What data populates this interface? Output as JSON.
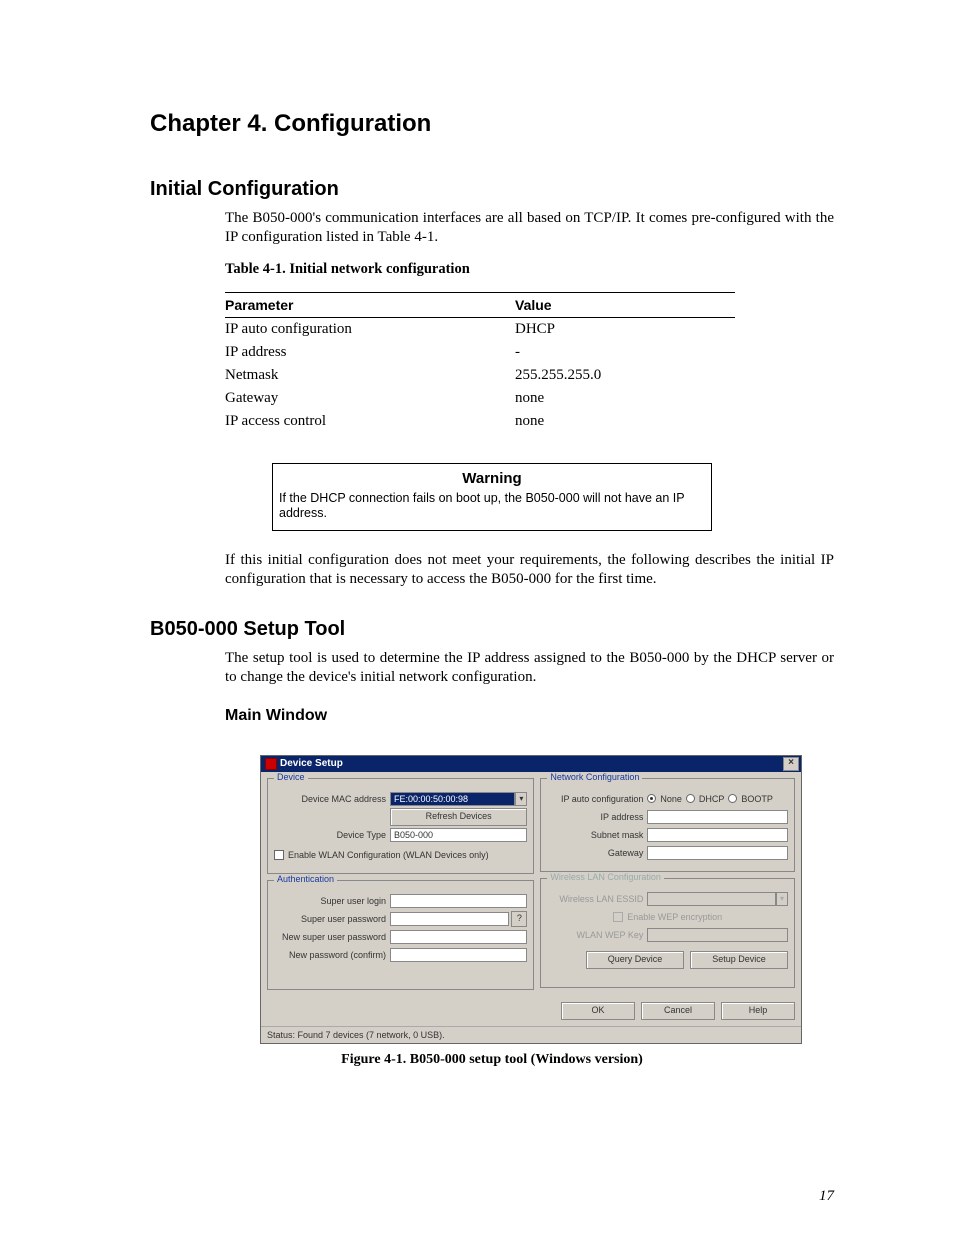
{
  "chapter_title": "Chapter 4. Configuration",
  "section1": {
    "title": "Initial Configuration",
    "intro": "The B050-000's communication interfaces are all based on TCP/IP. It comes pre-configured with the IP configuration listed in Table 4-1.",
    "table_caption": "Table 4-1. Initial network configuration",
    "table_headers": {
      "param": "Parameter",
      "value": "Value"
    },
    "table_rows": [
      {
        "param": "IP auto configuration",
        "value": "DHCP"
      },
      {
        "param": "IP address",
        "value": "-"
      },
      {
        "param": "Netmask",
        "value": "255.255.255.0"
      },
      {
        "param": "Gateway",
        "value": "none"
      },
      {
        "param": "IP access control",
        "value": "none"
      }
    ],
    "warning_title": "Warning",
    "warning_body": "If the DHCP connection fails on boot up, the B050-000 will not have an IP address.",
    "after": "If this initial configuration does not meet your requirements, the following describes the initial IP configuration that is necessary to access the B050-000 for the first time."
  },
  "section2": {
    "title": "B050-000 Setup Tool",
    "intro": "The setup tool is used to determine the IP address assigned to the B050-000 by the DHCP server or to change the device's initial network configuration.",
    "subsection": "Main Window"
  },
  "tool": {
    "window_title": "Device Setup",
    "close": "×",
    "device": {
      "legend": "Device",
      "mac_label": "Device MAC address",
      "mac_value": "FE:00:00:50:00:98",
      "refresh": "Refresh Devices",
      "type_label": "Device Type",
      "type_value": "B050-000",
      "wlan_chk": "Enable WLAN Configuration (WLAN Devices only)"
    },
    "network": {
      "legend": "Network Configuration",
      "ipauto_label": "IP auto configuration",
      "opt_none": "None",
      "opt_dhcp": "DHCP",
      "opt_bootp": "BOOTP",
      "ip_label": "IP address",
      "subnet_label": "Subnet mask",
      "gateway_label": "Gateway"
    },
    "auth": {
      "legend": "Authentication",
      "login_label": "Super user login",
      "pass_label": "Super user password",
      "newpass_label": "New super user password",
      "confirm_label": "New password (confirm)",
      "qmark": "?"
    },
    "wlan": {
      "legend": "Wireless LAN Configuration",
      "essid_label": "Wireless LAN ESSID",
      "wep_chk": "Enable WEP encryption",
      "wepkey_label": "WLAN WEP Key"
    },
    "buttons": {
      "query": "Query Device",
      "setup": "Setup Device",
      "ok": "OK",
      "cancel": "Cancel",
      "help": "Help"
    },
    "status": "Status: Found 7 devices (7 network, 0 USB)."
  },
  "figure_caption": "Figure 4-1. B050-000 setup tool (Windows version)",
  "page_number": "17"
}
